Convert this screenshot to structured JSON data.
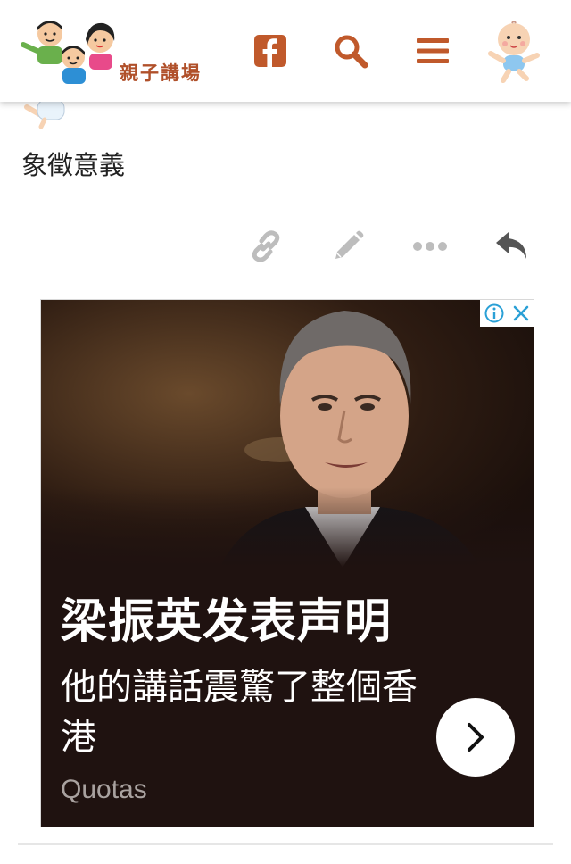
{
  "header": {
    "site_name": "親子講場",
    "icons": [
      "facebook-icon",
      "search-icon",
      "menu-icon",
      "baby-avatar"
    ],
    "accent_color": "#c0592b"
  },
  "post": {
    "text": "象徵意義",
    "actions": [
      "link-icon",
      "edit-icon",
      "more-icon",
      "reply-icon"
    ],
    "action_color": "#bdbdbd"
  },
  "ad": {
    "title": "梁振英发表声明",
    "description": "他的講話震驚了整個香港",
    "source": "Quotas",
    "adchoices": [
      "info-icon",
      "close-icon"
    ]
  }
}
